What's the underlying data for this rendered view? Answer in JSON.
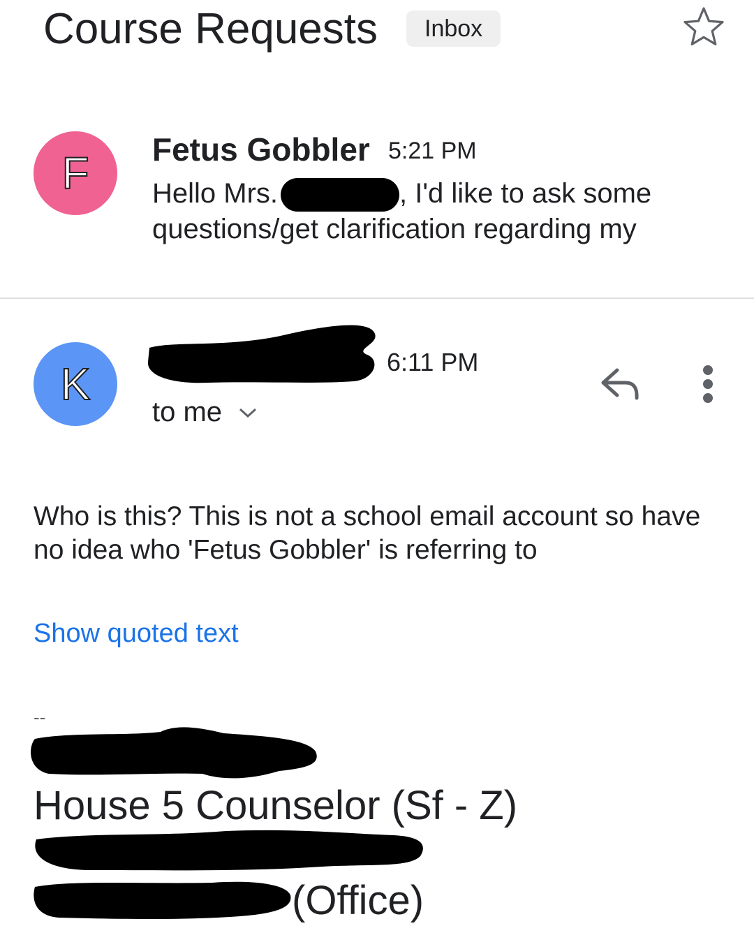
{
  "header": {
    "subject": "Course Requests",
    "label": "Inbox",
    "star_icon": "star-outline-icon"
  },
  "thread": {
    "messages": [
      {
        "avatar_letter": "F",
        "avatar_color": "#f06292",
        "sender": "Fetus Gobbler",
        "time": "5:21 PM",
        "snippet_start": "Hello Mrs.",
        "snippet_mid": ", I'd like to ask some",
        "snippet_line2": "questions/get clarification regarding my"
      },
      {
        "avatar_letter": "K",
        "avatar_color": "#5b95f5",
        "time": "6:11 PM",
        "recipients": "to me",
        "reply_icon": "reply-icon",
        "more_icon": "more-vert-icon",
        "body": "Who is this? This is not a school email account so have no idea who 'Fetus Gobbler' is referring to",
        "show_quoted": "Show quoted text",
        "signature": {
          "separator": "--",
          "title": "House 5 Counselor (Sf - Z)",
          "office": "(Office)"
        }
      }
    ]
  },
  "colors": {
    "link": "#1a73e8",
    "divider": "#e0e0e0",
    "chip_bg": "#efefef"
  }
}
